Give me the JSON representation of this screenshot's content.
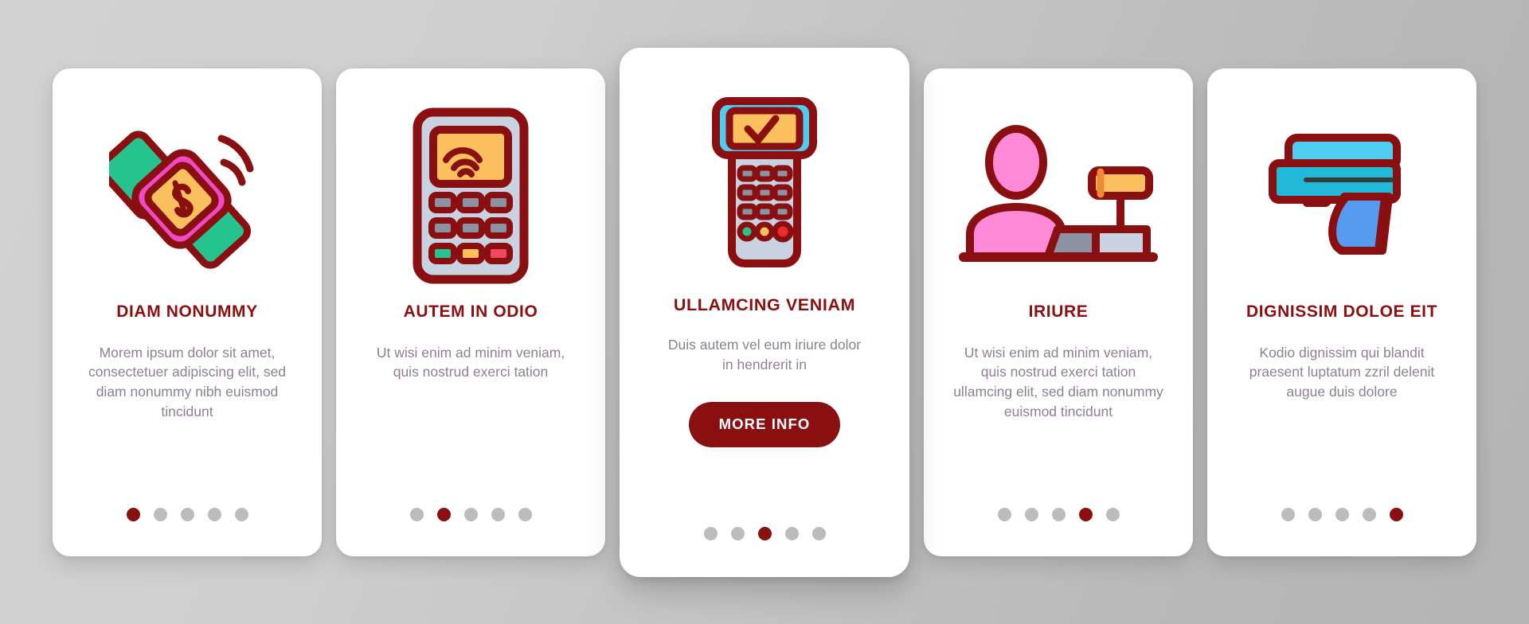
{
  "theme": {
    "accent": "#8a0f11",
    "body_text": "#8d8091",
    "dot_inactive": "#bcbcbc",
    "card_bg": "#ffffff",
    "page_bg": "#c6c6c6"
  },
  "cards": [
    {
      "icon_name": "smartwatch-payment-icon",
      "title": "DIAM NONUMMY",
      "body": "Morem ipsum dolor sit amet, consectetuer adipiscing elit, sed diam nonummy nibh euismod tincidunt",
      "featured": false,
      "dots": 5,
      "active_dot": 0
    },
    {
      "icon_name": "pos-terminal-contactless-icon",
      "title": "AUTEM IN ODIO",
      "body": "Ut wisi enim ad minim veniam, quis nostrud exerci tation",
      "featured": false,
      "dots": 5,
      "active_dot": 1
    },
    {
      "icon_name": "handheld-payment-terminal-approved-icon",
      "title": "ULLAMCING VENIAM",
      "body": "Duis autem vel eum iriure dolor in hendrerit in",
      "button_label": "MORE INFO",
      "featured": true,
      "dots": 5,
      "active_dot": 2
    },
    {
      "icon_name": "cashier-cash-register-icon",
      "title": "IRIURE",
      "body": "Ut wisi enim ad minim veniam, quis nostrud exerci tation ullamcing elit, sed diam nonummy euismod tincidunt",
      "featured": false,
      "dots": 5,
      "active_dot": 3
    },
    {
      "icon_name": "barcode-scanner-gun-icon",
      "title": "DIGNISSIM DOLOE EIT",
      "body": "Kodio dignissim qui blandit praesent luptatum zzril delenit augue duis dolore",
      "featured": false,
      "dots": 5,
      "active_dot": 4
    }
  ]
}
